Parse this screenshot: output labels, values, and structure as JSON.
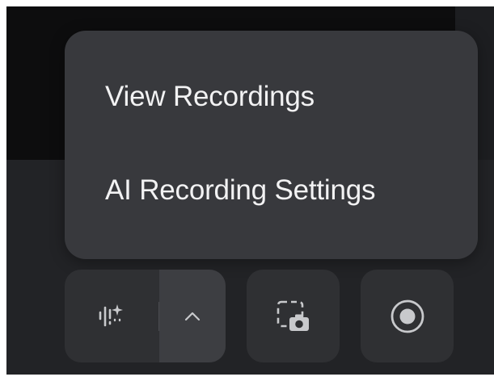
{
  "menu": {
    "items": [
      {
        "label": "View Recordings"
      },
      {
        "label": "AI Recording Settings"
      }
    ]
  },
  "toolbar": {
    "icons": [
      "ai-audio-icon",
      "chevron-up-icon",
      "screenshot-icon",
      "record-icon"
    ]
  },
  "colors": {
    "background": "#222326",
    "popup": "#38393d",
    "button": "#2f3033",
    "button_active": "#3d3e42",
    "text": "#f2f2f3",
    "icon": "#c8c9cc"
  }
}
